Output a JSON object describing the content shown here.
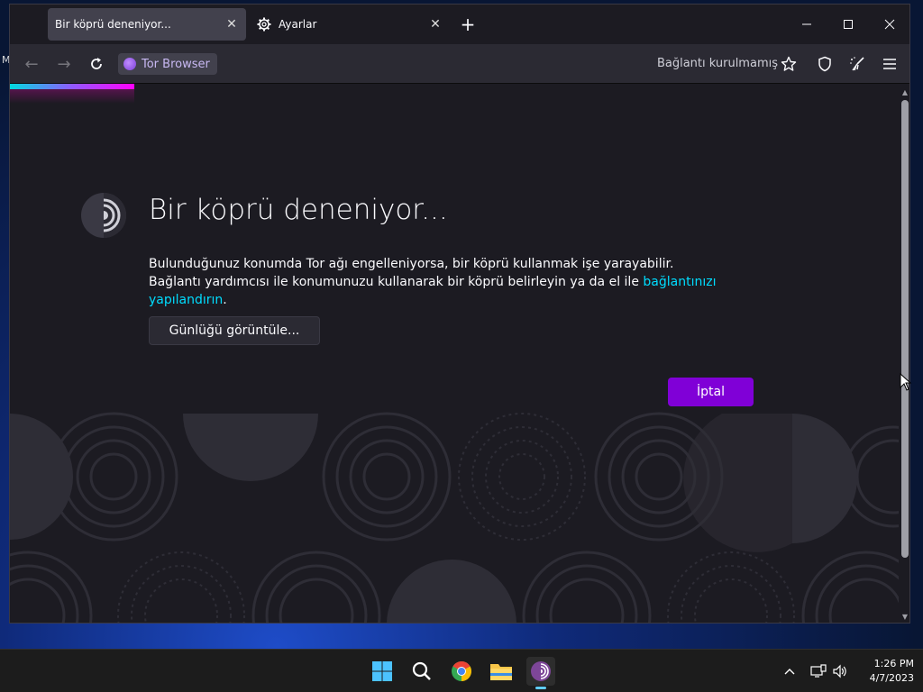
{
  "desktop": {
    "edge_label": "M"
  },
  "window": {
    "tabs": [
      {
        "title": "Bir köprü deneniyor...",
        "active": true
      },
      {
        "title": "Ayarlar",
        "active": false
      }
    ],
    "new_tab_label": "+"
  },
  "navbar": {
    "identity_label": "Tor Browser",
    "connection_status": "Bağlantı kurulmamış"
  },
  "page": {
    "heading": "Bir köprü deneniyor...",
    "description_text": "Bulunduğunuz konumda Tor ağı engelleniyorsa, bir köprü kullanmak işe yarayabilir. Bağlantı yardımcısı ile konumunuzu kullanarak bir köprü belirleyin ya da el ile ",
    "description_link": "bağlantınızı yapılandırın",
    "description_end": ".",
    "view_log_button": "Günlüğü görüntüle...",
    "cancel_button": "İptal"
  },
  "colors": {
    "accent": "#8000d7",
    "link": "#00ddff",
    "background": "#1c1b22"
  },
  "taskbar": {
    "apps": [
      "windows-start-icon",
      "search-icon",
      "chrome-icon",
      "file-explorer-icon",
      "tor-browser-icon"
    ],
    "clock_time": "1:26 PM",
    "clock_date": "4/7/2023"
  }
}
